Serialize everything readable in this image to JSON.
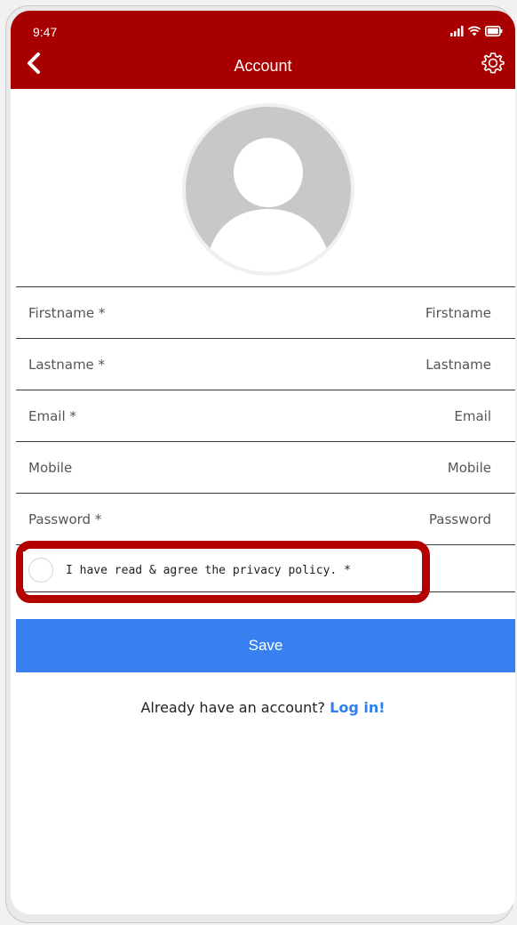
{
  "status_bar": {
    "time": "9:47"
  },
  "header": {
    "title": "Account",
    "background": "#a80000",
    "back_icon": "chevron-left-icon",
    "settings_icon": "gear-icon"
  },
  "avatar": {
    "icon": "user-placeholder-icon"
  },
  "form": {
    "fields": [
      {
        "label": "Firstname *",
        "placeholder": "Firstname"
      },
      {
        "label": "Lastname *",
        "placeholder": "Lastname"
      },
      {
        "label": "Email *",
        "placeholder": "Email"
      },
      {
        "label": "Mobile",
        "placeholder": "Mobile"
      },
      {
        "label": "Password *",
        "placeholder": "Password"
      }
    ],
    "privacy_label": "I have read & agree the privacy policy. *"
  },
  "actions": {
    "save_label": "Save",
    "save_color": "#3880f0"
  },
  "footer": {
    "prompt": "Already have an account?",
    "login_link": "Log in!",
    "link_color": "#2f7ef0"
  }
}
